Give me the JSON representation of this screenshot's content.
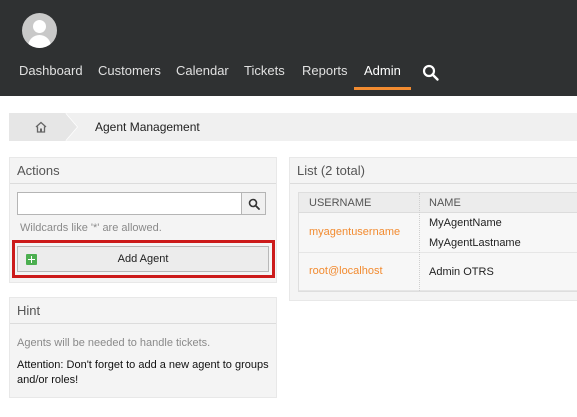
{
  "header": {
    "nav": [
      {
        "label": "Dashboard"
      },
      {
        "label": "Customers"
      },
      {
        "label": "Calendar"
      },
      {
        "label": "Tickets"
      },
      {
        "label": "Reports"
      },
      {
        "label": "Admin",
        "active": true
      }
    ],
    "search_icon": "search-icon",
    "accent_color": "#f28b30"
  },
  "breadcrumb": {
    "home_icon": "home-icon",
    "title": "Agent Management"
  },
  "actions": {
    "title": "Actions",
    "search": {
      "value": "",
      "placeholder": ""
    },
    "wildcard_hint": "Wildcards like '*' are allowed.",
    "add_agent_label": "Add Agent"
  },
  "hint": {
    "title": "Hint",
    "text1": "Agents will be needed to handle tickets.",
    "text2": "Attention: Don't forget to add a new agent to groups and/or roles!"
  },
  "list": {
    "title": "List (2 total)",
    "columns": [
      "USERNAME",
      "NAME"
    ],
    "rows": [
      {
        "username": "myagentusername",
        "name_line1": "MyAgentName",
        "name_line2": "MyAgentLastname"
      },
      {
        "username": "root@localhost",
        "name_line1": "Admin OTRS",
        "name_line2": ""
      }
    ]
  }
}
